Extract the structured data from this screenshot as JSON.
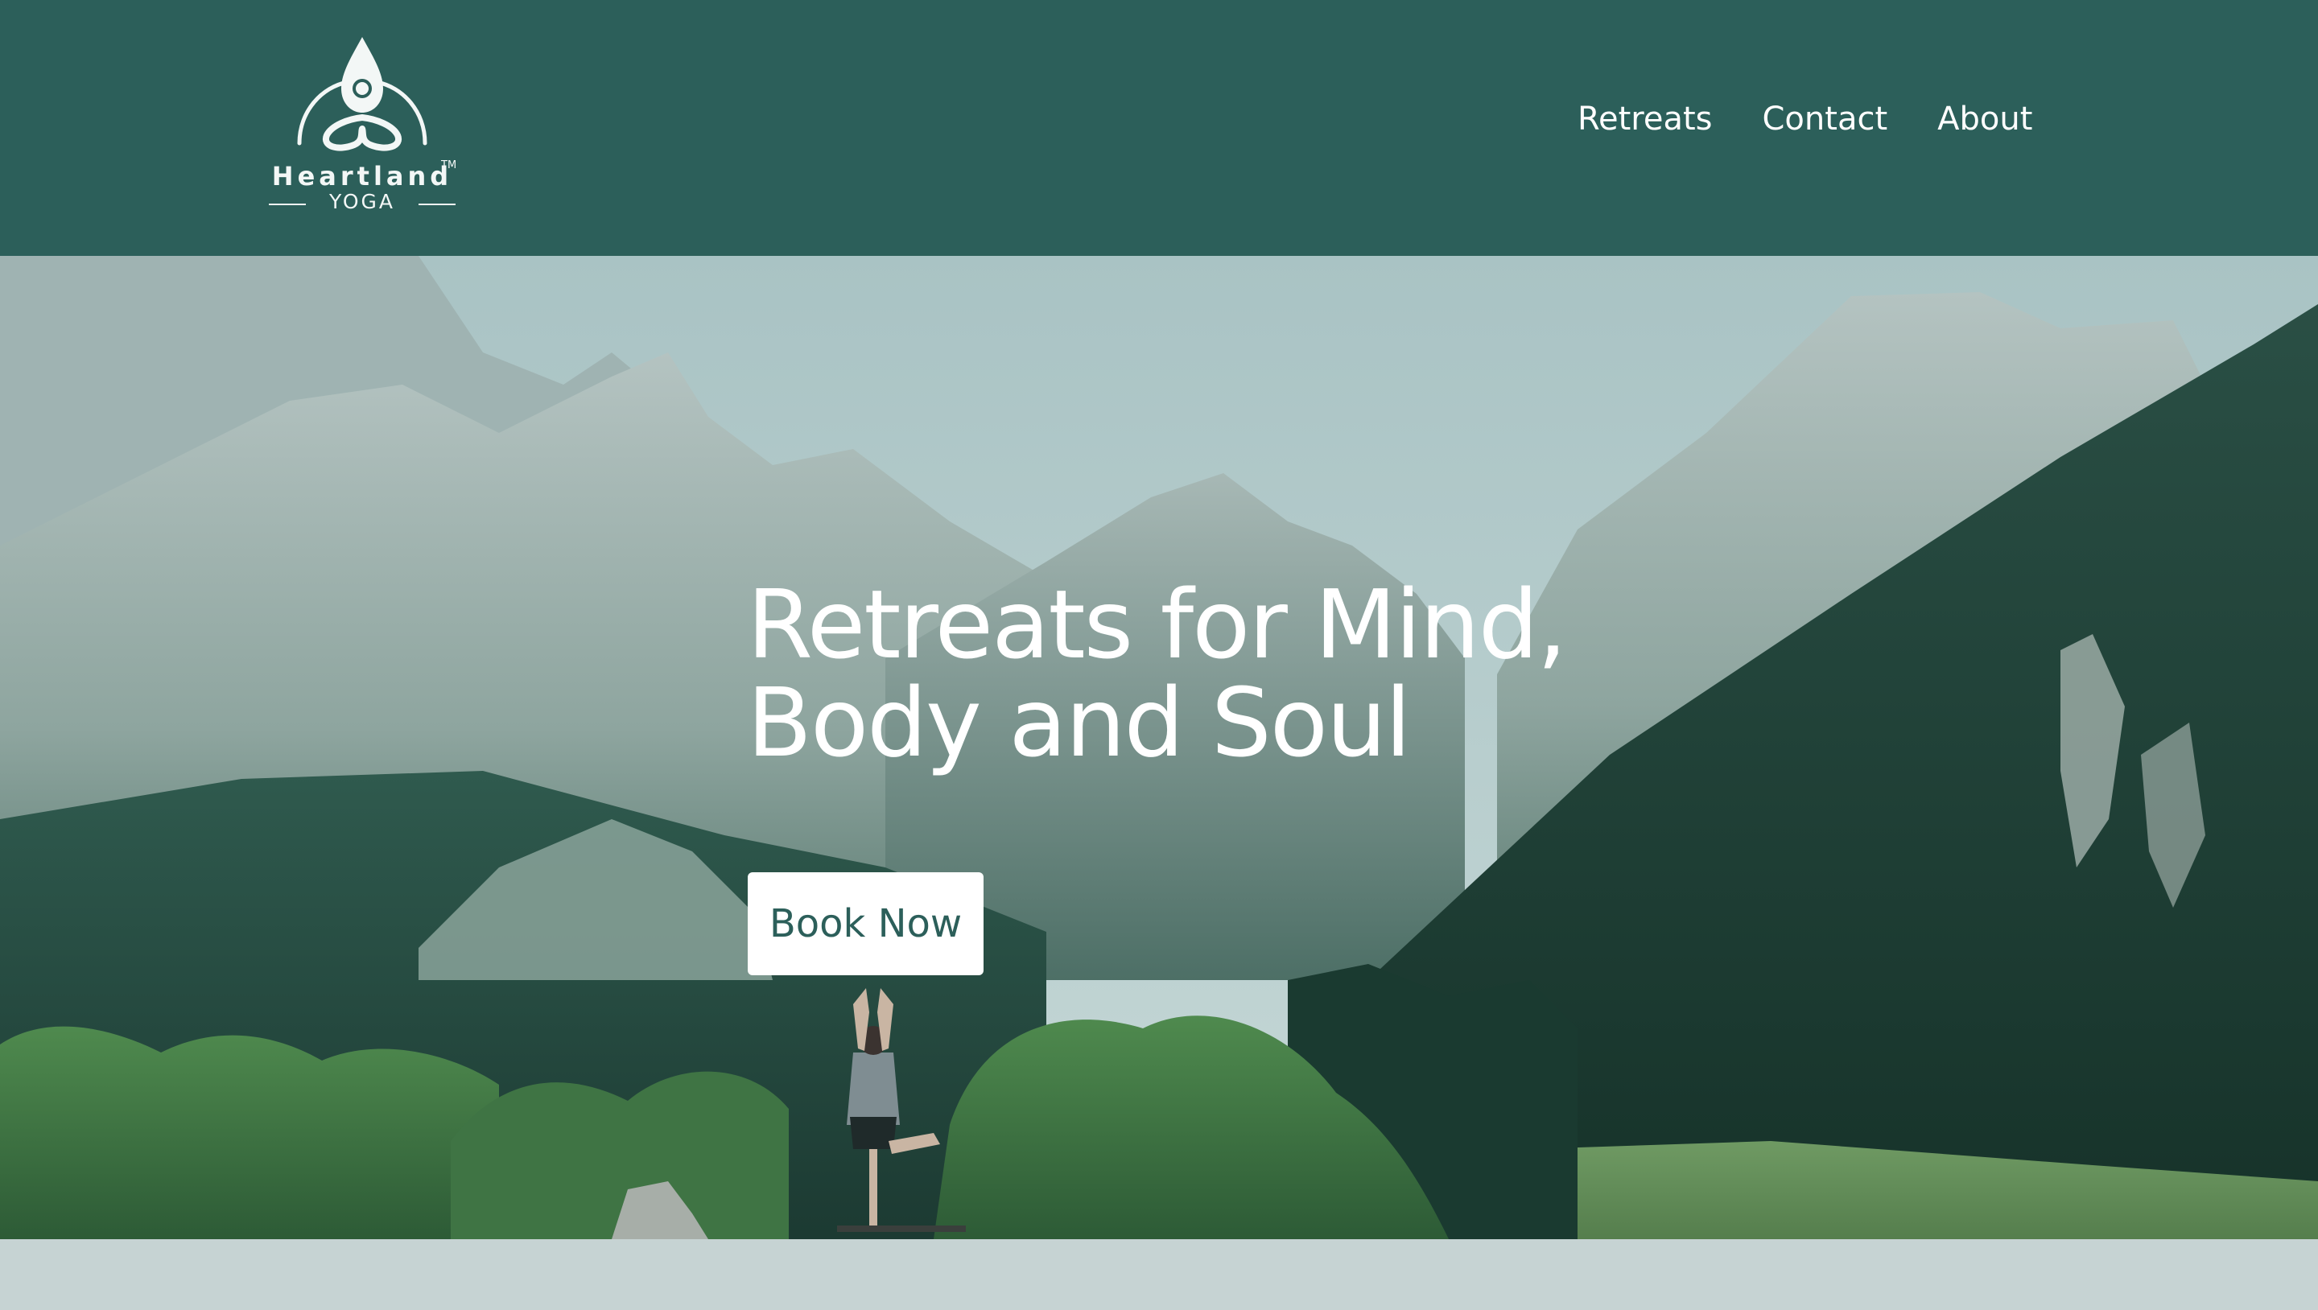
{
  "brand": {
    "name": "Heartland",
    "trademark": "TM",
    "subtitle": "YOGA",
    "logo_icon": "meditating-figure-drop-icon"
  },
  "nav": {
    "items": [
      {
        "label": "Retreats"
      },
      {
        "label": "Contact"
      },
      {
        "label": "About"
      }
    ]
  },
  "hero": {
    "title_line1": "Retreats for Mind,",
    "title_line2": "Body and Soul",
    "cta_label": "Book Now",
    "image": "mountain-valley-yoga-tree-pose-photo"
  },
  "colors": {
    "header_bg": "#2c5f5a",
    "accent": "#2c5f5a",
    "footer_bg": "#c6d3d3",
    "text_on_dark": "#ffffff"
  }
}
